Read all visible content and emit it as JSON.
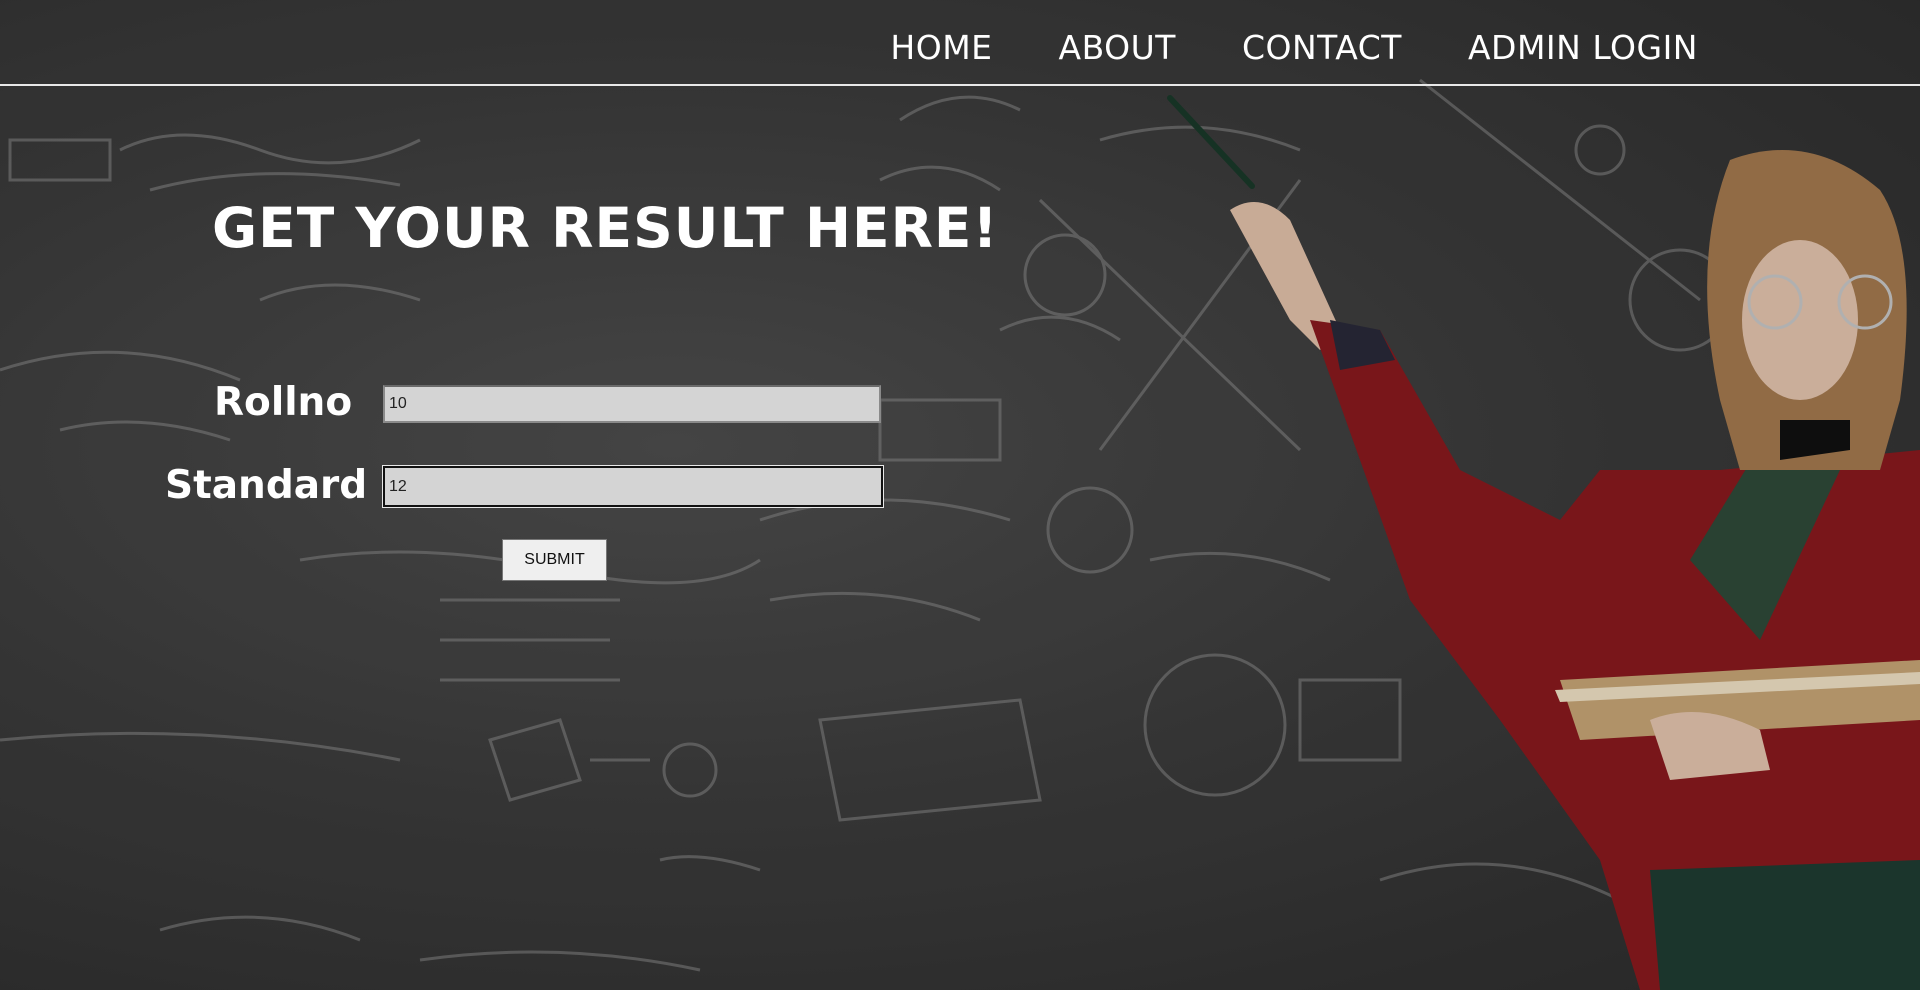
{
  "nav": {
    "items": [
      {
        "label": "HOME"
      },
      {
        "label": "ABOUT"
      },
      {
        "label": "CONTACT"
      },
      {
        "label": "ADMIN LOGIN"
      }
    ]
  },
  "main": {
    "headline": "GET YOUR RESULT HERE!",
    "form": {
      "rollno_label": "Rollno",
      "rollno_value": "10",
      "standard_label": "Standard",
      "standard_value": "12",
      "submit_label": "SUBMIT"
    }
  },
  "colors": {
    "text": "#ffffff",
    "background": "#3d3d3d",
    "input_background": "#d4d4d4",
    "button_background": "#efefef"
  }
}
